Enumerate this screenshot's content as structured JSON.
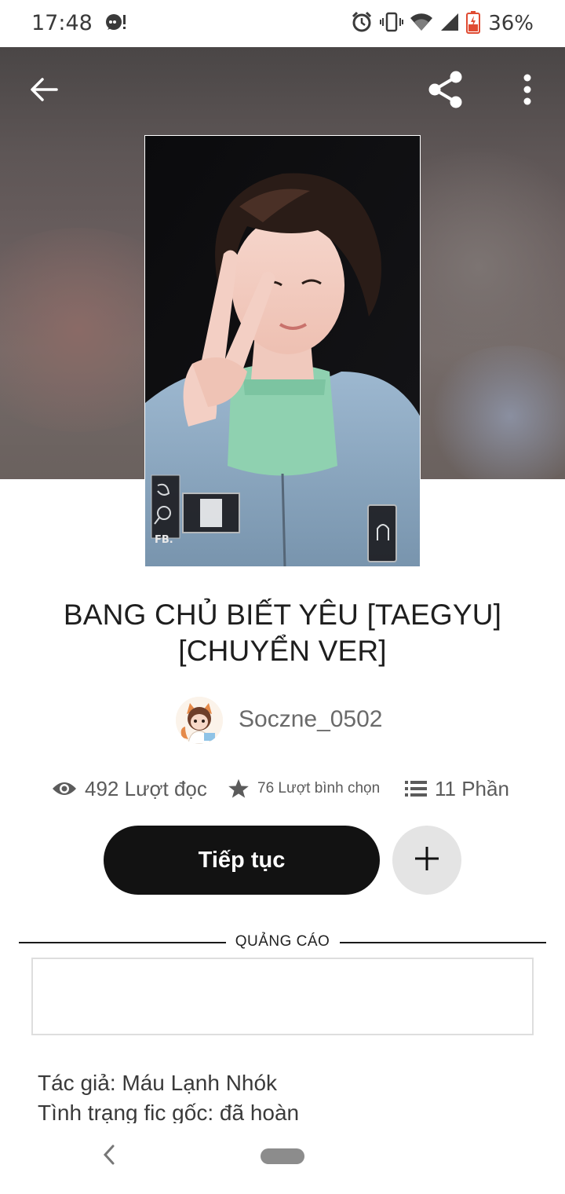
{
  "status_bar": {
    "time": "17:48",
    "battery_percent": "36%",
    "icons": [
      "notification-icon",
      "alarm-icon",
      "vibrate-icon",
      "wifi-icon",
      "signal-icon",
      "battery-icon"
    ]
  },
  "toolbar": {
    "icons": [
      "back-arrow-icon",
      "share-icon",
      "more-vert-icon"
    ]
  },
  "story": {
    "title": "BANG CHỦ BIẾT YÊU [TAEGYU] [CHUYỂN VER]",
    "author": "Soczne_0502",
    "reads": "492 Lượt đọc",
    "votes": "76 Lượt bình chọn",
    "parts": "11 Phần"
  },
  "cover_overlay": {
    "watermark": "FB."
  },
  "actions": {
    "continue_label": "Tiếp tục",
    "add_icon": "plus-icon"
  },
  "ad": {
    "label": "QUẢNG CÁO"
  },
  "description": {
    "line1": "Tác giả: Máu Lạnh Nhók",
    "line2": "Tình trạng fic gốc: đã hoàn"
  },
  "colors": {
    "primary_button": "#121212",
    "secondary_button": "#e4e4e4",
    "text_main": "#1e1e1e",
    "text_muted": "#5b5b5b"
  }
}
